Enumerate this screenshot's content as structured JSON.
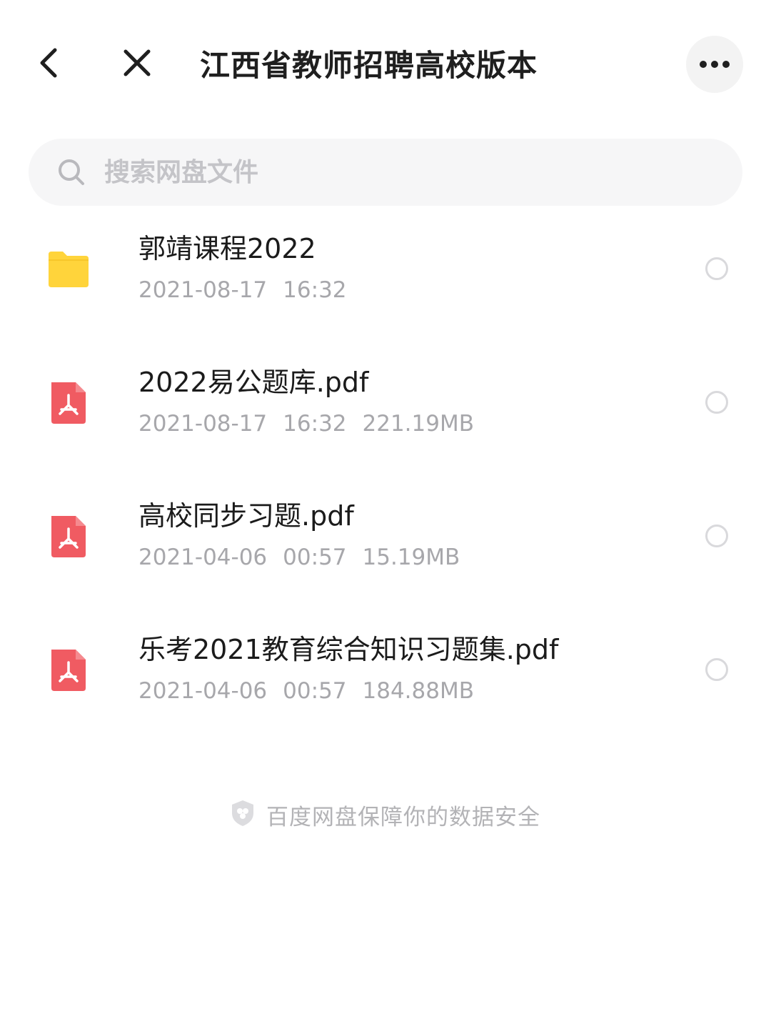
{
  "header": {
    "title": "江西省教师招聘高校版本",
    "back_icon": "chevron-left-icon",
    "close_icon": "close-icon",
    "more_icon": "more-horizontal-icon"
  },
  "search": {
    "placeholder": "搜索网盘文件",
    "icon": "search-icon"
  },
  "files": [
    {
      "type": "folder",
      "name": "郭靖课程2022",
      "date": "2021-08-17",
      "time": "16:32",
      "size": ""
    },
    {
      "type": "pdf",
      "name": "2022易公题库.pdf",
      "date": "2021-08-17",
      "time": "16:32",
      "size": "221.19MB"
    },
    {
      "type": "pdf",
      "name": "高校同步习题.pdf",
      "date": "2021-04-06",
      "time": "00:57",
      "size": "15.19MB"
    },
    {
      "type": "pdf",
      "name": "乐考2021教育综合知识习题集.pdf",
      "date": "2021-04-06",
      "time": "00:57",
      "size": "184.88MB"
    }
  ],
  "footer": {
    "text": "百度网盘保障你的数据安全",
    "icon": "shield-icon"
  },
  "colors": {
    "folder": "#FFD43B",
    "pdf": "#F05B62",
    "text_primary": "#1B1B1B",
    "text_secondary": "#A7A7AB"
  }
}
